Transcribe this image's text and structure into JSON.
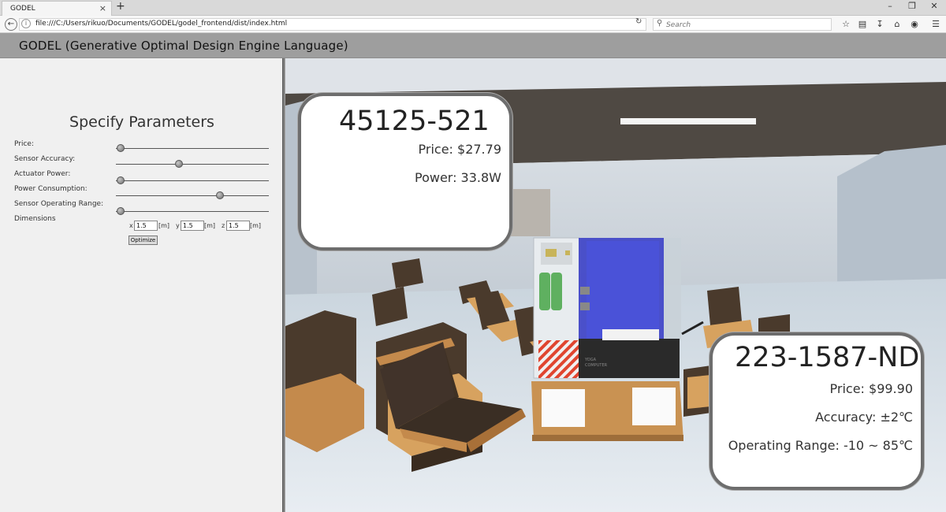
{
  "browser": {
    "tab_title": "GODEL",
    "tab_close": "×",
    "new_tab": "+",
    "url": "file:///C:/Users/rikuo/Documents/GODEL/godel_frontend/dist/index.html",
    "search_placeholder": "Search"
  },
  "app": {
    "title": "GODEL (Generative Optimal Design Engine Language)"
  },
  "parameters": {
    "title": "Specify Parameters",
    "items": [
      {
        "label": "Price:",
        "value": 0.03
      },
      {
        "label": "Sensor Accuracy:",
        "value": 0.41
      },
      {
        "label": "Actuator Power:",
        "value": 0.03
      },
      {
        "label": "Power Consumption:",
        "value": 0.68
      },
      {
        "label": "Sensor Operating Range:",
        "value": 0.03
      }
    ],
    "dimensions": {
      "label": "Dimensions",
      "x_prefix": "x",
      "y_prefix": "y",
      "z_prefix": "z",
      "x_value": "1.5",
      "y_value": "1.5",
      "z_value": "1.5",
      "unit": "[m]"
    },
    "optimize_label": "Optimize"
  },
  "cards": {
    "left": {
      "part": "45125-521",
      "price": "Price: $27.79",
      "power": "Power: 33.8W"
    },
    "right": {
      "part": "223-1587-ND",
      "price": "Price: $99.90",
      "accuracy": "Accuracy: ±2℃",
      "range": "Operating Range: -10 ~ 85℃"
    }
  },
  "device": {
    "label_line1": "YOGA",
    "label_line2": "COMPUTER"
  }
}
